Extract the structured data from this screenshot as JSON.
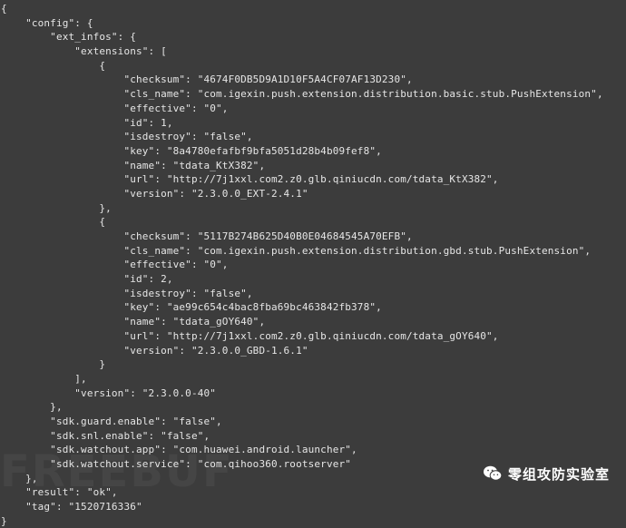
{
  "terminal": {
    "lines": [
      "{",
      "    \"config\": {",
      "        \"ext_infos\": {",
      "            \"extensions\": [",
      "                {",
      "                    \"checksum\": \"4674F0DB5D9A1D10F5A4CF07AF13D230\",",
      "                    \"cls_name\": \"com.igexin.push.extension.distribution.basic.stub.PushExtension\",",
      "                    \"effective\": \"0\",",
      "                    \"id\": 1,",
      "                    \"isdestroy\": \"false\",",
      "                    \"key\": \"8a4780efafbf9bfa5051d28b4b09fef8\",",
      "                    \"name\": \"tdata_KtX382\",",
      "                    \"url\": \"http://7j1xxl.com2.z0.glb.qiniucdn.com/tdata_KtX382\",",
      "                    \"version\": \"2.3.0.0_EXT-2.4.1\"",
      "                },",
      "                {",
      "                    \"checksum\": \"5117B274B625D40B0E04684545A70EFB\",",
      "                    \"cls_name\": \"com.igexin.push.extension.distribution.gbd.stub.PushExtension\",",
      "                    \"effective\": \"0\",",
      "                    \"id\": 2,",
      "                    \"isdestroy\": \"false\",",
      "                    \"key\": \"ae99c654c4bac8fba69bc463842fb378\",",
      "                    \"name\": \"tdata_gOY640\",",
      "                    \"url\": \"http://7j1xxl.com2.z0.glb.qiniucdn.com/tdata_gOY640\",",
      "                    \"version\": \"2.3.0.0_GBD-1.6.1\"",
      "                }",
      "            ],",
      "            \"version\": \"2.3.0.0-40\"",
      "        },",
      "        \"sdk.guard.enable\": \"false\",",
      "        \"sdk.snl.enable\": \"false\",",
      "        \"sdk.watchout.app\": \"com.huawei.android.launcher\",",
      "        \"sdk.watchout.service\": \"com.qihoo360.rootserver\"",
      "    },",
      "    \"result\": \"ok\",",
      "    \"tag\": \"1520716336\"",
      "}"
    ]
  },
  "watermark": {
    "text": "FREEBUF",
    "brand_label": "零组攻防实验室",
    "icon": "wechat-icon"
  },
  "colors": {
    "background": "#3c3c3c",
    "text": "#e6e6e6"
  }
}
